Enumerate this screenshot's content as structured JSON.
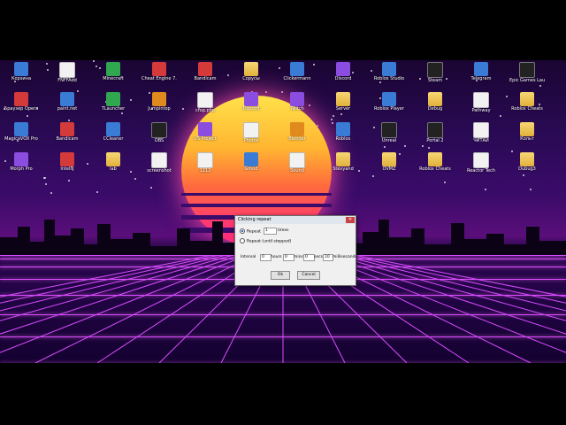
{
  "dialog": {
    "title": "Clicking repeat",
    "close_glyph": "✕",
    "repeat_label": "Repeat",
    "repeat_value": "1",
    "times_label": "times",
    "until_stopped_label": "Repeat (until stopped)",
    "interval_label": "Interval",
    "hours_value": "0",
    "hours_label": "hours",
    "mins_value": "0",
    "mins_label": "mins",
    "secs_value": "0",
    "secs_label": "secs",
    "ms_value": "10",
    "ms_label": "milliseconds",
    "ok_label": "Ok",
    "cancel_label": "Cancel"
  },
  "desktop_icons": [
    {
      "label": "Корзина",
      "kind": "app1"
    },
    {
      "label": "FNFFAdd",
      "kind": "file"
    },
    {
      "label": "Minecraft",
      "kind": "app3"
    },
    {
      "label": "Cheat Engine 7.2",
      "kind": "app2"
    },
    {
      "label": "Bandicam",
      "kind": "app2"
    },
    {
      "label": "Сорусы",
      "kind": "folder"
    },
    {
      "label": "Clickermann",
      "kind": "app1"
    },
    {
      "label": "Discord",
      "kind": "app5"
    },
    {
      "label": "Roblox Studio",
      "kind": "app1"
    },
    {
      "label": "Steam",
      "kind": "app4"
    },
    {
      "label": "Telegram",
      "kind": "app1"
    },
    {
      "label": "Epic Games Launcher",
      "kind": "app4"
    },
    {
      "label": "Браузер Opera",
      "kind": "app2"
    },
    {
      "label": "paint.net",
      "kind": "app1"
    },
    {
      "label": "TLauncher",
      "kind": "app3"
    },
    {
      "label": "Jumpintop",
      "kind": "app6"
    },
    {
      "label": "crop.php",
      "kind": "file"
    },
    {
      "label": "Discord",
      "kind": "app5"
    },
    {
      "label": "Twitch",
      "kind": "app5"
    },
    {
      "label": "Server",
      "kind": "folder"
    },
    {
      "label": "Roblox Player",
      "kind": "app1"
    },
    {
      "label": "Debug",
      "kind": "folder"
    },
    {
      "label": "Pathway",
      "kind": "file"
    },
    {
      "label": "Roblox Cheats",
      "kind": "folder"
    },
    {
      "label": "MagicaVOX Pro",
      "kind": "app1"
    },
    {
      "label": "Bandicam",
      "kind": "app2"
    },
    {
      "label": "CCleaner",
      "kind": "app1"
    },
    {
      "label": "OBS",
      "kind": "app4"
    },
    {
      "label": "VS Project",
      "kind": "app5"
    },
    {
      "label": "Photos",
      "kind": "file"
    },
    {
      "label": "Blender",
      "kind": "app6"
    },
    {
      "label": "Roblox",
      "kind": "app1"
    },
    {
      "label": "Unreal",
      "kind": "app4"
    },
    {
      "label": "Portal 2",
      "kind": "app4"
    },
    {
      "label": "ЧИТАЙ",
      "kind": "file"
    },
    {
      "label": "Кольт",
      "kind": "folder"
    },
    {
      "label": "Morph Pro",
      "kind": "app5"
    },
    {
      "label": "IntelliJ",
      "kind": "app2"
    },
    {
      "label": "lab",
      "kind": "folder"
    },
    {
      "label": "screenshot",
      "kind": "file"
    },
    {
      "label": "1212",
      "kind": "file"
    },
    {
      "label": "Gmod",
      "kind": "app1"
    },
    {
      "label": "Sound",
      "kind": "file"
    },
    {
      "label": "Stevyand",
      "kind": "folder"
    },
    {
      "label": "OVMZ",
      "kind": "folder"
    },
    {
      "label": "Roblox Cheats",
      "kind": "folder"
    },
    {
      "label": "Reactor Tech",
      "kind": "file"
    },
    {
      "label": "Dubug3",
      "kind": "folder"
    }
  ],
  "colors": {
    "sun_top": "#ffe14a",
    "sun_bottom": "#ff2f7a",
    "grid": "#d94cff",
    "sky": "#2a0a55"
  }
}
